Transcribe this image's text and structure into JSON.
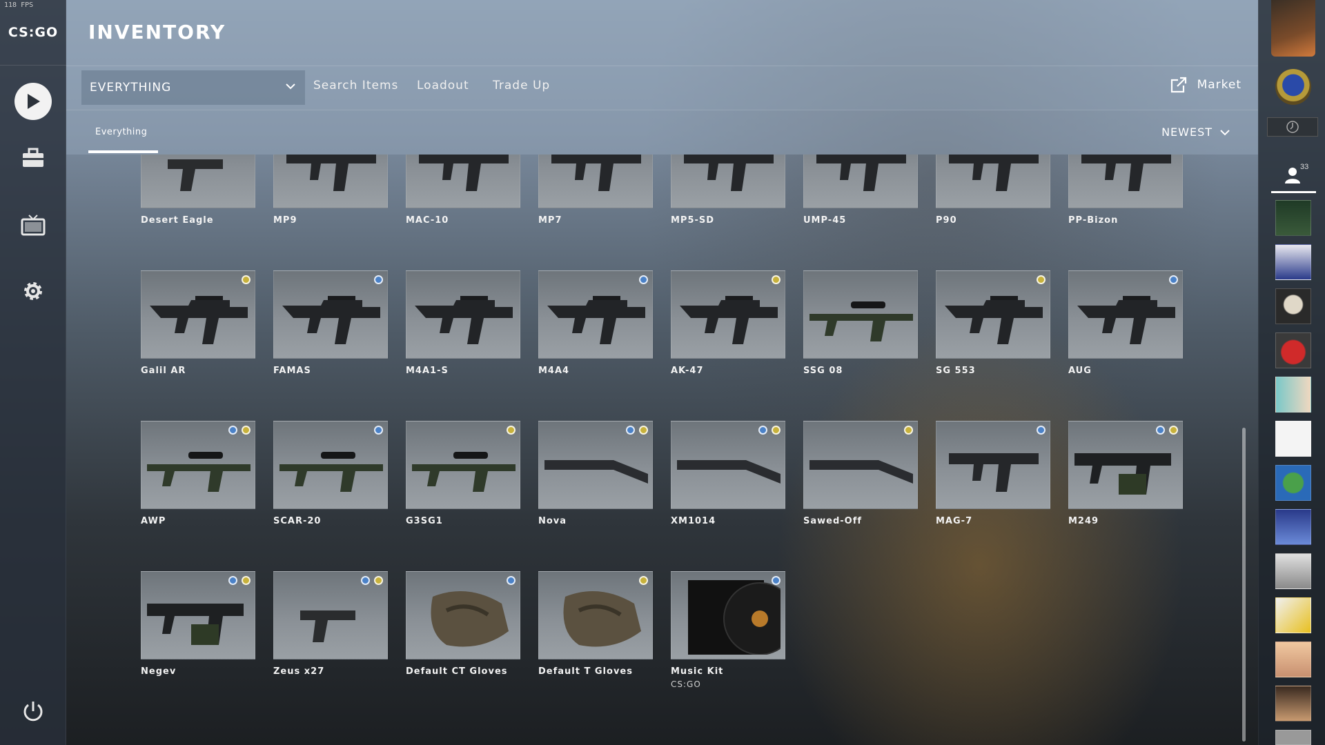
{
  "fps": "118 FPS",
  "logo": "CS:GO",
  "header": {
    "title": "INVENTORY"
  },
  "toolbar": {
    "filter_value": "EVERYTHING",
    "search_label": "Search Items",
    "loadout_label": "Loadout",
    "tradeup_label": "Trade Up",
    "market_label": "Market"
  },
  "subbar": {
    "tab_label": "Everything",
    "sort_label": "NEWEST"
  },
  "friends": {
    "count": "33"
  },
  "colors": {
    "dot_blue": "#4b82c8",
    "dot_gold": "#c8b23c"
  },
  "items": [
    {
      "name": "Desert Eagle",
      "dots": []
    },
    {
      "name": "MP9",
      "dots": []
    },
    {
      "name": "MAC-10",
      "dots": []
    },
    {
      "name": "MP7",
      "dots": []
    },
    {
      "name": "MP5-SD",
      "dots": []
    },
    {
      "name": "UMP-45",
      "dots": []
    },
    {
      "name": "P90",
      "dots": []
    },
    {
      "name": "PP-Bizon",
      "dots": []
    },
    {
      "name": "Galil AR",
      "dots": [
        "gold"
      ]
    },
    {
      "name": "FAMAS",
      "dots": [
        "blue"
      ]
    },
    {
      "name": "M4A1-S",
      "dots": []
    },
    {
      "name": "M4A4",
      "dots": [
        "blue"
      ]
    },
    {
      "name": "AK-47",
      "dots": [
        "gold"
      ]
    },
    {
      "name": "SSG 08",
      "dots": []
    },
    {
      "name": "SG 553",
      "dots": [
        "gold"
      ]
    },
    {
      "name": "AUG",
      "dots": [
        "blue"
      ]
    },
    {
      "name": "AWP",
      "dots": [
        "blue",
        "gold"
      ]
    },
    {
      "name": "SCAR-20",
      "dots": [
        "blue"
      ]
    },
    {
      "name": "G3SG1",
      "dots": [
        "gold"
      ]
    },
    {
      "name": "Nova",
      "dots": [
        "blue",
        "gold"
      ]
    },
    {
      "name": "XM1014",
      "dots": [
        "blue",
        "gold"
      ]
    },
    {
      "name": "Sawed-Off",
      "dots": [
        "gold"
      ]
    },
    {
      "name": "MAG-7",
      "dots": [
        "blue"
      ]
    },
    {
      "name": "M249",
      "dots": [
        "blue",
        "gold"
      ]
    },
    {
      "name": "Negev",
      "dots": [
        "blue",
        "gold"
      ]
    },
    {
      "name": "Zeus x27",
      "dots": [
        "blue",
        "gold"
      ]
    },
    {
      "name": "Default CT Gloves",
      "dots": [
        "blue"
      ]
    },
    {
      "name": "Default T Gloves",
      "dots": [
        "gold"
      ]
    },
    {
      "name": "Music Kit",
      "sub": "CS:GO",
      "dots": [
        "blue"
      ]
    }
  ]
}
